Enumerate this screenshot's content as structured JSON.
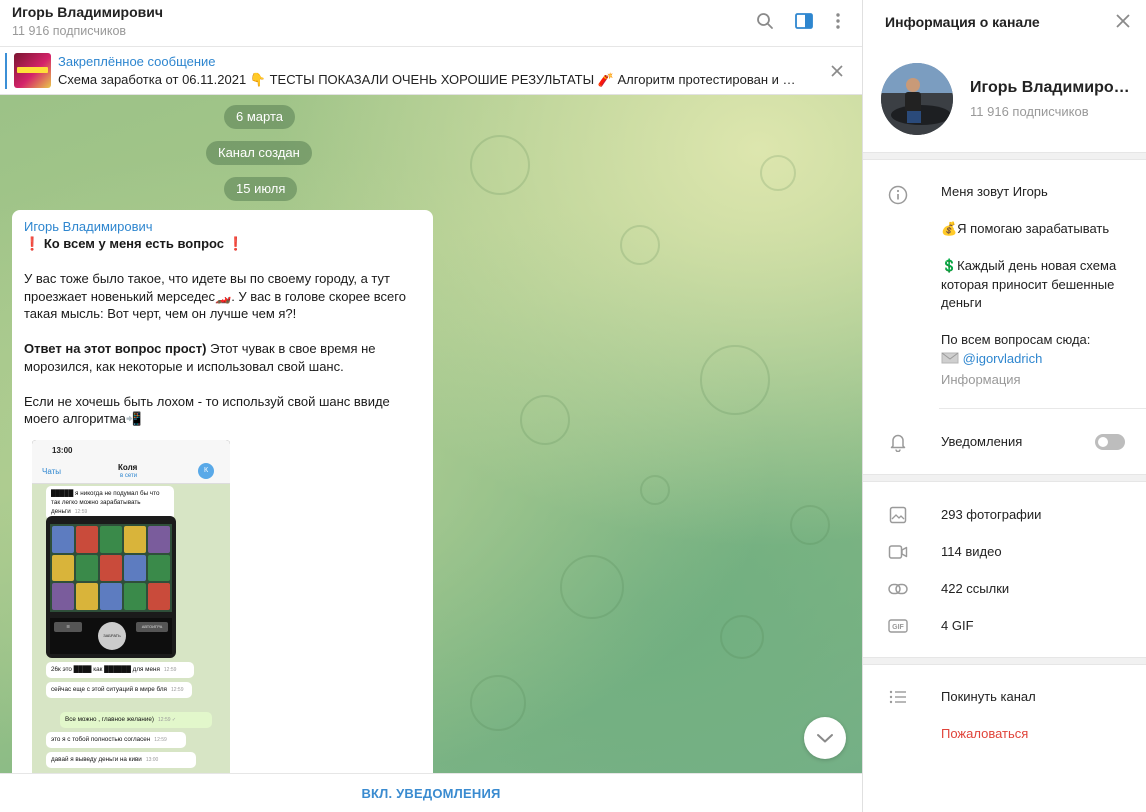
{
  "header": {
    "title": "Игорь Владимирович",
    "subscribers": "11 916 подписчиков",
    "icons": [
      "search-icon",
      "sidebar-toggle-icon",
      "more-vertical-icon"
    ]
  },
  "pinned": {
    "title": "Закреплённое сообщение",
    "text": "Схема заработка от 06.11.2021 👇  ТЕСТЫ ПОКАЗАЛИ ОЧЕНЬ ХОРОШИЕ РЕЗУЛЬТАТЫ 🧨  Алгоритм протестирован и по..."
  },
  "service": {
    "date1": "6 марта",
    "created": "Канал создан",
    "date2": "15 июля"
  },
  "post": {
    "author": "Игорь Владимирович",
    "l1_emoji": "❗",
    "l1_text": "Ко всем у меня есть вопрос",
    "p2": "У вас тоже было такое, что идете вы по своему городу, а тут проезжает  новенький мерседес🏎️. У вас в голове скорее всего такая мысль: Вот черт, чем он лучше чем я?!",
    "p3_bold": "Ответ на этот вопрос прост)",
    "p3_rest": " Этот чувак в свое время не морозился, как некоторые и использовал свой шанс.",
    "p4": "Если не хочешь быть лохом - то используй свой шанс ввиде моего алгоритма📲"
  },
  "phone": {
    "time": "13:00",
    "back": "Чаты",
    "name": "Коля",
    "online": "в сети",
    "avatar": "К",
    "m1": "█████ я никогда не подумал бы что так легко можно зарабатывать деньги",
    "m1_time": "12:59",
    "m2": "26к это ████ как ██████ для меня",
    "m2_time": "12:59",
    "m3": "сейчас еще с этой ситуаций в мире бля",
    "m3_time": "12:59",
    "m4": "Все можно , главное желание)",
    "m4_time": "12:59 ✓",
    "m5": "это я с тобой полностью согласен",
    "m5_time": "12:59",
    "m6": "давай я выведу деньги на киви",
    "m6_time": "13:00",
    "btn_spin": "ЗАБРАТЬ",
    "btn_auto": "АВТОИГРА"
  },
  "bottom": {
    "notify_button": "ВКЛ. УВЕДОМЛЕНИЯ"
  },
  "panel": {
    "title": "Информация о канале",
    "name": "Игорь Владимирович",
    "subscribers": "11 916 подписчиков",
    "desc_l1": "Меня зовут Игорь",
    "desc_l2": "💰Я помогаю зарабатывать",
    "desc_l3": "💲Каждый день новая схема которая приносит бешенные деньги",
    "desc_l4": "По всем вопросам сюда:",
    "desc_link": "@igorvladrich",
    "info_label": "Информация",
    "notifications": "Уведомления",
    "notifications_on": false,
    "photos": "293 фотографии",
    "videos": "114 видео",
    "links": "422 ссылки",
    "gifs": "4 GIF",
    "leave": "Покинуть канал",
    "report": "Пожаловаться"
  },
  "colors": {
    "accent": "#2e86cf",
    "danger": "#e0443a",
    "service_pill": "#5f8a58"
  }
}
